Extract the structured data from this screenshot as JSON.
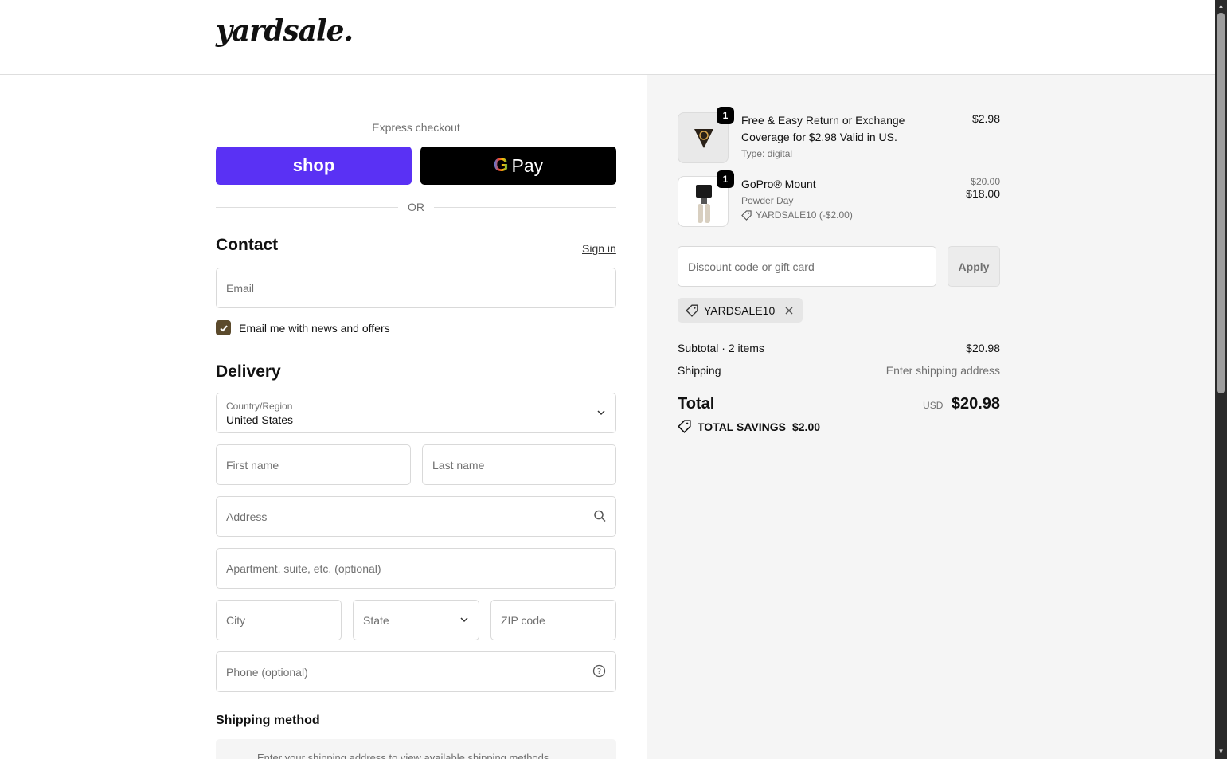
{
  "brand": {
    "logo_text": "yardsale."
  },
  "express": {
    "label": "Express checkout",
    "shop_label": "shop",
    "gpay_g": "G",
    "gpay_label": "Pay",
    "or_text": "OR"
  },
  "contact": {
    "title": "Contact",
    "signin_label": "Sign in",
    "email_placeholder": "Email",
    "newsletter_label": "Email me with news and offers",
    "newsletter_checked": true
  },
  "delivery": {
    "title": "Delivery",
    "country_label": "Country/Region",
    "country_value": "United States",
    "first_name_placeholder": "First name",
    "last_name_placeholder": "Last name",
    "address_placeholder": "Address",
    "apartment_placeholder": "Apartment, suite, etc. (optional)",
    "city_placeholder": "City",
    "state_placeholder": "State",
    "zip_placeholder": "ZIP code",
    "phone_placeholder": "Phone (optional)"
  },
  "shipping_method": {
    "title": "Shipping method",
    "message": "Enter your shipping address to view available shipping methods."
  },
  "cart": {
    "items": [
      {
        "name": "Free & Easy Return or Exchange Coverage for $2.98 Valid in US.",
        "quantity": "1",
        "subtitle": "Type: digital",
        "price": "$2.98"
      },
      {
        "name": "GoPro® Mount",
        "quantity": "1",
        "subtitle": "Powder Day",
        "discount": "YARDSALE10 (-$2.00)",
        "original_price": "$20.00",
        "price": "$18.00"
      }
    ],
    "discount_placeholder": "Discount code or gift card",
    "apply_label": "Apply",
    "applied_code": "YARDSALE10",
    "subtotal_label": "Subtotal · 2 items",
    "subtotal_value": "$20.98",
    "shipping_label": "Shipping",
    "shipping_value": "Enter shipping address",
    "total_label": "Total",
    "total_currency": "USD",
    "total_value": "$20.98",
    "savings_label": "TOTAL SAVINGS",
    "savings_value": "$2.00"
  },
  "colors": {
    "shop_purple": "#5a31f4",
    "gpay_black": "#000000",
    "checkbox_brown": "#5b4a2c",
    "summary_bg": "#f5f5f5"
  }
}
